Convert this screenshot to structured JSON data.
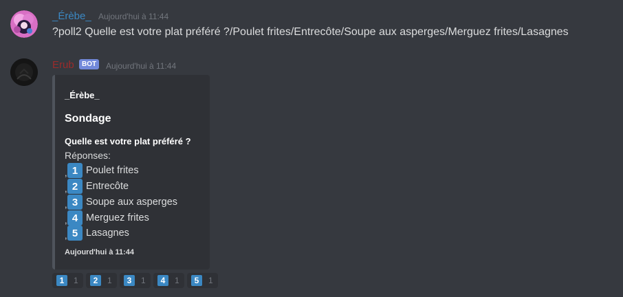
{
  "messages": [
    {
      "username": "_Érèbe_",
      "username_color": "#3b88c3",
      "timestamp": "Aujourd'hui à 11:44",
      "content": "?poll2 Quelle est votre plat préféré ?/Poulet frites/Entrecôte/Soupe aux asperges/Merguez frites/Lasagnes"
    },
    {
      "username": "Erub",
      "username_color": "#9b2b2b",
      "bot_tag": "BOT",
      "timestamp": "Aujourd'hui à 11:44",
      "embed": {
        "author": "_Érèbe_",
        "title": "Sondage",
        "question": "Quelle est votre plat préféré ?",
        "answers_label": "Réponses:",
        "options": [
          {
            "emoji": "1",
            "label": "Poulet frites"
          },
          {
            "emoji": "2",
            "label": "Entrecôte"
          },
          {
            "emoji": "3",
            "label": "Soupe aux asperges"
          },
          {
            "emoji": "4",
            "label": "Merguez frites"
          },
          {
            "emoji": "5",
            "label": "Lasagnes"
          }
        ],
        "footer": "Aujourd'hui à 11:44"
      },
      "reactions": [
        {
          "emoji": "1",
          "count": "1"
        },
        {
          "emoji": "2",
          "count": "1"
        },
        {
          "emoji": "3",
          "count": "1"
        },
        {
          "emoji": "4",
          "count": "1"
        },
        {
          "emoji": "5",
          "count": "1"
        }
      ]
    }
  ],
  "colors": {
    "background": "#36393f",
    "embed_background": "#2f3136",
    "embed_border": "#4f545c",
    "keycap": "#3b88c3",
    "bot_tag": "#7289da",
    "timestamp": "#72767d",
    "text": "#dcddde"
  }
}
